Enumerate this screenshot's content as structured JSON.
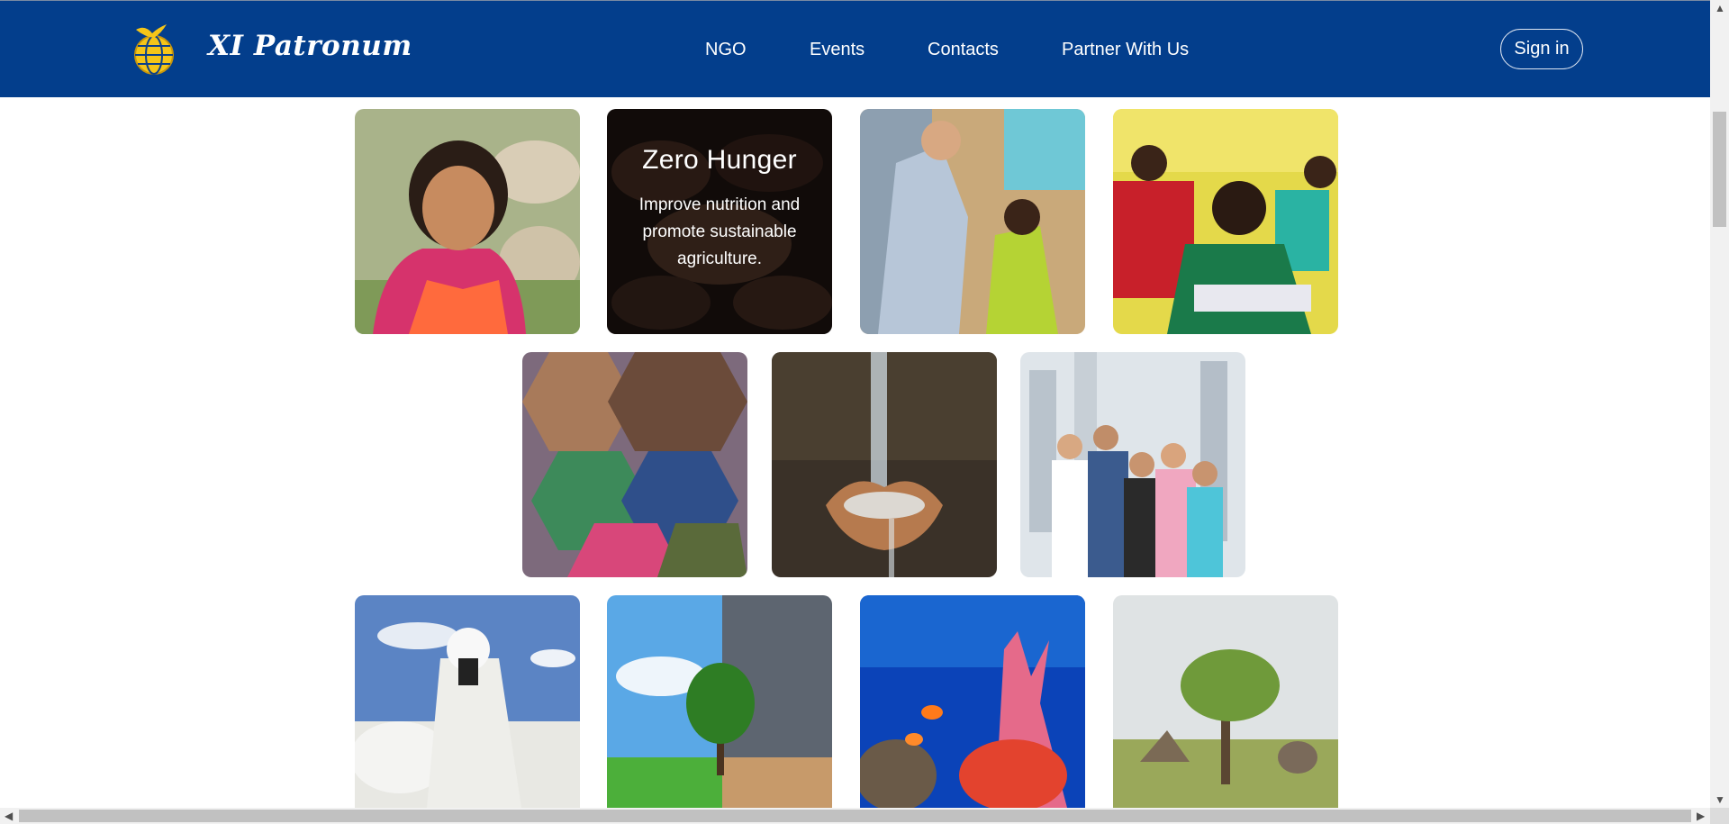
{
  "header": {
    "brand": "XI Patronum",
    "nav": [
      "NGO",
      "Events",
      "Contacts",
      "Partner With Us"
    ],
    "signin_label": "Sign in"
  },
  "tiles": {
    "zero_hunger": {
      "title": "Zero Hunger",
      "description": "Improve nutrition and promote sustainable agriculture."
    }
  },
  "colors": {
    "header_bg": "#033e8c",
    "overlay": "#000000"
  }
}
